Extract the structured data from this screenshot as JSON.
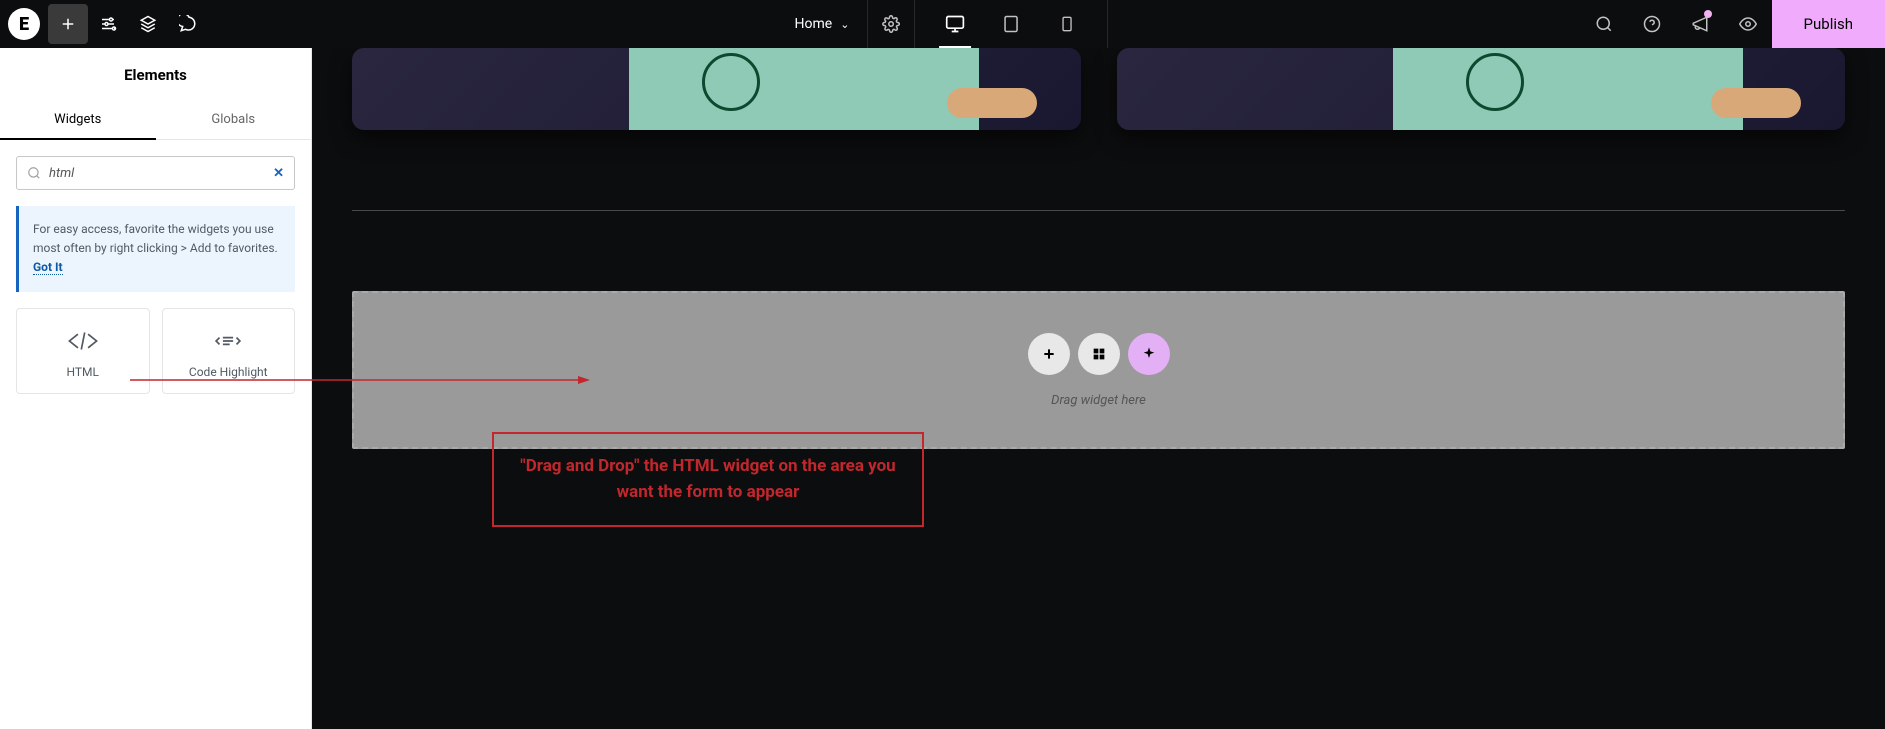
{
  "topbar": {
    "page_name": "Home",
    "publish_label": "Publish"
  },
  "sidebar": {
    "title": "Elements",
    "tabs": {
      "widgets": "Widgets",
      "globals": "Globals"
    },
    "search_value": "html",
    "tip_text": "For easy access, favorite the widgets you use most often by right clicking > Add to favorites.",
    "tip_link": "Got It",
    "widgets": {
      "html": "HTML",
      "code_highlight": "Code Highlight"
    }
  },
  "dropzone": {
    "hint": "Drag widget here"
  },
  "annotation": {
    "text": "\"Drag and Drop\" the HTML widget on the area you want the form to appear"
  }
}
